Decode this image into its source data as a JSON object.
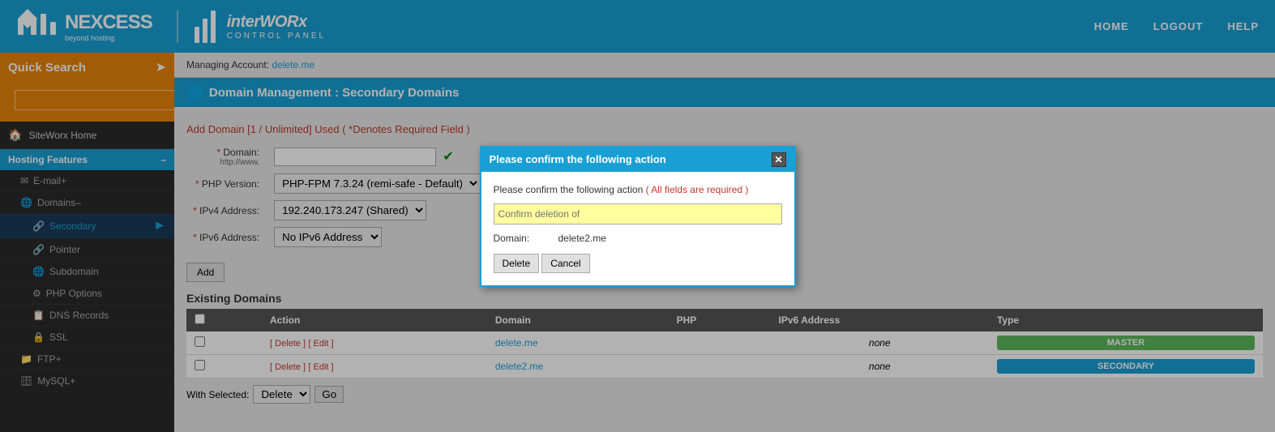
{
  "header": {
    "logo_nexcess": "NEXCESS",
    "logo_sub": "beyond hosting.",
    "logo_interworx": "interWORx",
    "logo_control_panel": "CONTROL PANEL",
    "nav": {
      "home": "HOME",
      "logout": "LOGOUT",
      "help": "HELP"
    }
  },
  "sidebar": {
    "quick_search_label": "Quick Search",
    "quick_search_placeholder": "",
    "items": [
      {
        "label": "SiteWorx Home",
        "icon": "🏠",
        "type": "item"
      },
      {
        "label": "Hosting Features",
        "icon": "⚙",
        "type": "section"
      },
      {
        "label": "E-mail",
        "icon": "✉",
        "type": "subitem",
        "expandable": true
      },
      {
        "label": "Domains",
        "icon": "🌐",
        "type": "subitem",
        "expandable": true,
        "active": true
      },
      {
        "label": "Secondary",
        "icon": "🔗",
        "type": "deepitem",
        "active": true
      },
      {
        "label": "Pointer",
        "icon": "🔗",
        "type": "deepitem"
      },
      {
        "label": "Subdomain",
        "icon": "🌐",
        "type": "deepitem"
      },
      {
        "label": "PHP Options",
        "icon": "⚙",
        "type": "deepitem"
      },
      {
        "label": "DNS Records",
        "icon": "📋",
        "type": "deepitem"
      },
      {
        "label": "SSL",
        "icon": "🔒",
        "type": "deepitem"
      },
      {
        "label": "FTP",
        "icon": "📁",
        "type": "subitem",
        "expandable": true
      },
      {
        "label": "MySQL",
        "icon": "🗄",
        "type": "subitem",
        "expandable": true
      }
    ]
  },
  "managing_account": {
    "label": "Managing Account:",
    "account": "delete.me"
  },
  "page_title": "Domain Management : Secondary Domains",
  "add_domain": {
    "title": "Add Domain [1 / Unlimited] Used",
    "required_note": "( *Denotes Required Field )",
    "fields": {
      "domain_label": "* Domain:",
      "domain_sublabel": "http://www.",
      "php_label": "* PHP Version:",
      "php_default": "PHP-FPM 7.3.24 (remi-safe - Default)",
      "ipv4_label": "* IPv4 Address:",
      "ipv4_default": "192.240.173.247 (Shared)",
      "ipv6_label": "* IPv6 Address:",
      "ipv6_default": "No IPv6 Address"
    },
    "add_button": "Add"
  },
  "existing_domains": {
    "title": "Existing Domains",
    "columns": [
      "Action",
      "Domain",
      "PHP",
      "IPv6 Address",
      "Type"
    ],
    "rows": [
      {
        "domain": "delete.me",
        "php": "",
        "ipv6": "none",
        "type": "MASTER",
        "actions": [
          "Delete",
          "Edit"
        ]
      },
      {
        "domain": "delete2.me",
        "php": "",
        "ipv6": "none",
        "type": "SECONDARY",
        "actions": [
          "Delete",
          "Edit"
        ]
      }
    ],
    "with_selected_label": "With Selected:",
    "bulk_options": [
      "Delete"
    ],
    "go_button": "Go"
  },
  "modal": {
    "title": "Please confirm the following action",
    "close_icon": "✕",
    "confirm_text": "Please confirm the following action",
    "required_note": "( All fields are required )",
    "confirm_input_placeholder": "Confirm deletion of",
    "domain_label": "Domain:",
    "domain_value": "delete2.me",
    "delete_button": "Delete",
    "cancel_button": "Cancel"
  },
  "colors": {
    "blue": "#1a9fd4",
    "orange": "#e8850a",
    "green": "#5cb85c",
    "red": "#c0392b",
    "dark": "#2a2a2a"
  }
}
